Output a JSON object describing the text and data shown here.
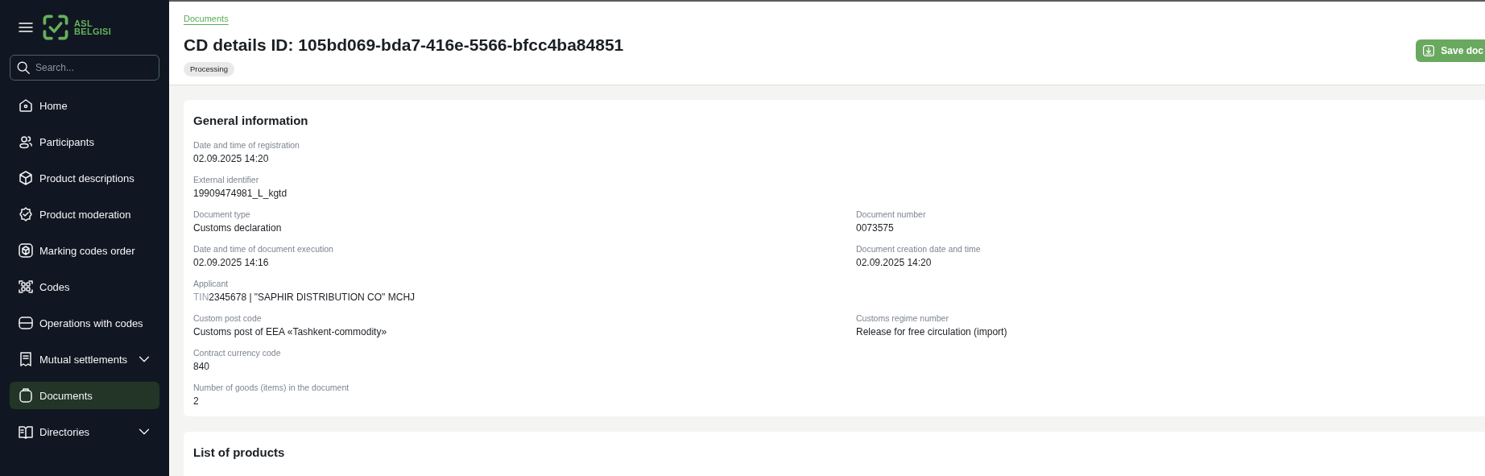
{
  "sidebar": {
    "logo": {
      "line_1": "ASL",
      "line_2": "BELGISI"
    },
    "search": {
      "placeholder": "Search..."
    },
    "items": [
      {
        "label": "Home",
        "kind": "link",
        "selected": false
      },
      {
        "label": "Participants",
        "kind": "link",
        "selected": false
      },
      {
        "label": "Product descriptions",
        "kind": "link",
        "selected": false
      },
      {
        "label": "Product moderation",
        "kind": "link",
        "selected": false
      },
      {
        "label": "Marking codes order",
        "kind": "link",
        "selected": false
      },
      {
        "label": "Codes",
        "kind": "link",
        "selected": false
      },
      {
        "label": "Operations with codes",
        "kind": "link",
        "selected": false
      },
      {
        "label": "Mutual settlements",
        "kind": "group",
        "selected": false
      },
      {
        "label": "Documents",
        "kind": "link",
        "selected": true
      },
      {
        "label": "Directories",
        "kind": "group",
        "selected": false
      }
    ]
  },
  "header": {
    "breadcrumb": "Documents",
    "title": "CD details ID: 105bd069-bda7-416e-5566-bfcc4ba84851",
    "status": "Processing",
    "save_button": "Save doc"
  },
  "general_information": {
    "title": "General information",
    "rows": [
      {
        "left": {
          "label": "Date and time of registration",
          "value": "02.09.2025 14:20"
        }
      },
      {
        "left": {
          "label": "External identifier",
          "value": "19909474981_L_kgtd"
        }
      },
      {
        "left": {
          "label": "Document type",
          "value": "Customs declaration"
        },
        "right": {
          "label": "Document number",
          "value": "0073575"
        }
      },
      {
        "left": {
          "label": "Date and time of document execution",
          "value": "02.09.2025 14:16"
        },
        "right": {
          "label": "Document creation date and time",
          "value": "02.09.2025 14:20"
        }
      },
      {
        "left": {
          "label": "Applicant",
          "prefix": "TIN",
          "value": "2345678 | \"SAPHIR DISTRIBUTION CO\" MCHJ"
        }
      },
      {
        "left": {
          "label": "Custom post code",
          "value": "Customs post of EEA «Tashkent-commodity»"
        },
        "right": {
          "label": "Customs regime number",
          "value": "Release for free circulation (import)"
        }
      },
      {
        "left": {
          "label": "Contract currency code",
          "value": "840"
        }
      },
      {
        "left": {
          "label": "Number of goods (items) in the document",
          "value": "2"
        }
      }
    ]
  },
  "products": {
    "title": "List of products"
  }
}
